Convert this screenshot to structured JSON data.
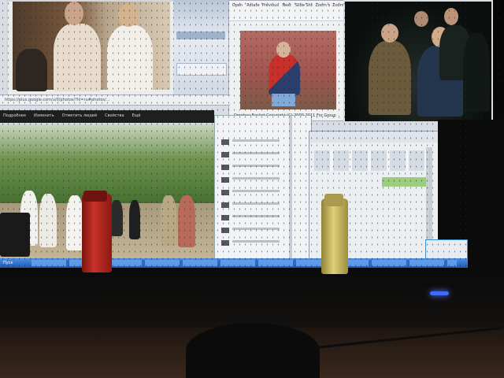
{
  "scene": {
    "colors": {
      "monitor_bezel": "#060606",
      "screen_glow": "#dfe3ea",
      "taskbar": "#2c6fd0",
      "power_led": "#3d6bff",
      "red_lighter": "#b3261e",
      "yellow_lighter": "#c9b85a",
      "desk": "#2a1e16"
    }
  },
  "screen": {
    "browser": {
      "url": "https://plus.google.com/u/0/photos/?hl=ru#photos/...",
      "menu_items": [
        "Подробнее",
        "Изменить",
        "Отметить людей",
        "Свойства",
        "Ещё"
      ]
    },
    "viewer": {
      "toolbar_items": [
        "Open",
        "Rotate",
        "Previous",
        "Next",
        "Slide Show",
        "Zoom out",
        "Zoom in"
      ]
    },
    "editor": {
      "status_text": "Dropbox Basket Copyright (C) 2000-2011 For Group"
    },
    "taskbar": {
      "start_label": "Пуск"
    }
  }
}
